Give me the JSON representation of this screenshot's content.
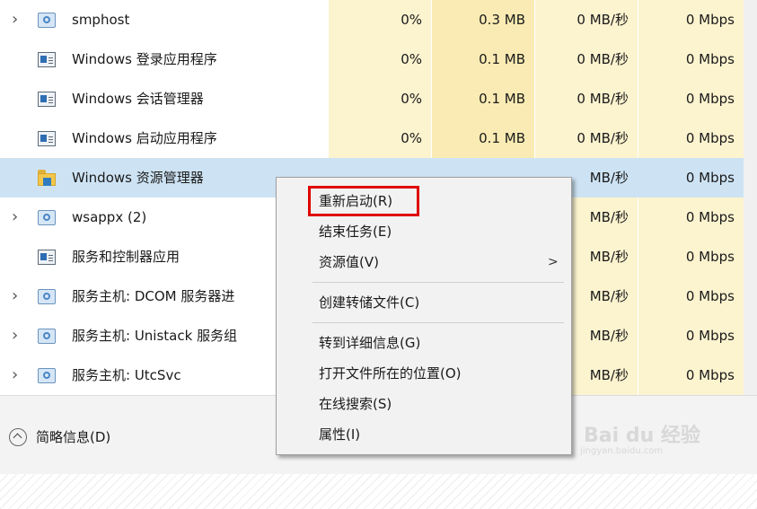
{
  "processes": [
    {
      "name": "smphost",
      "icon": "gear-icon",
      "expandable": true,
      "cpu": "0%",
      "memory": "0.3 MB",
      "disk": "0 MB/秒",
      "network": "0 Mbps"
    },
    {
      "name": "Windows 登录应用程序",
      "icon": "window-icon",
      "expandable": false,
      "cpu": "0%",
      "memory": "0.1 MB",
      "disk": "0 MB/秒",
      "network": "0 Mbps"
    },
    {
      "name": "Windows 会话管理器",
      "icon": "window-icon",
      "expandable": false,
      "cpu": "0%",
      "memory": "0.1 MB",
      "disk": "0 MB/秒",
      "network": "0 Mbps"
    },
    {
      "name": "Windows 启动应用程序",
      "icon": "window-icon",
      "expandable": false,
      "cpu": "0%",
      "memory": "0.1 MB",
      "disk": "0 MB/秒",
      "network": "0 Mbps"
    },
    {
      "name": "Windows 资源管理器",
      "icon": "explorer-folder-icon",
      "expandable": false,
      "selected": true,
      "cpu": "",
      "memory": "",
      "disk": "MB/秒",
      "network": "0 Mbps"
    },
    {
      "name": "wsappx (2)",
      "icon": "gear-icon",
      "expandable": true,
      "cpu": "",
      "memory": "",
      "disk": "MB/秒",
      "network": "0 Mbps"
    },
    {
      "name": "服务和控制器应用",
      "icon": "window-icon",
      "expandable": false,
      "cpu": "",
      "memory": "",
      "disk": "MB/秒",
      "network": "0 Mbps"
    },
    {
      "name": "服务主机: DCOM 服务器进",
      "icon": "gear-icon",
      "expandable": true,
      "cpu": "",
      "memory": "",
      "disk": "MB/秒",
      "network": "0 Mbps"
    },
    {
      "name": "服务主机: Unistack 服务组",
      "icon": "gear-icon",
      "expandable": true,
      "cpu": "",
      "memory": "",
      "disk": "MB/秒",
      "network": "0 Mbps"
    },
    {
      "name": "服务主机: UtcSvc",
      "icon": "gear-icon",
      "expandable": true,
      "cpu": "",
      "memory": "",
      "disk": "MB/秒",
      "network": "0 Mbps"
    }
  ],
  "footer": {
    "collapse_label": "简略信息(D)",
    "watermark": "Bai du 经验",
    "watermark_sub": "jingyan.baidu.com"
  },
  "context_menu": {
    "items": [
      {
        "label": "重新启动(R)",
        "highlighted": true
      },
      {
        "label": "结束任务(E)"
      },
      {
        "label": "资源值(V)",
        "submenu": true,
        "arrow": ">"
      },
      {
        "label": "创建转储文件(C)"
      },
      {
        "label": "转到详细信息(G)"
      },
      {
        "label": "打开文件所在的位置(O)"
      },
      {
        "label": "在线搜索(S)"
      },
      {
        "label": "属性(I)"
      }
    ]
  },
  "colors": {
    "selected_row": "#cde3f4",
    "cpu_heat": "#fcf3cf",
    "memory_heat": "#f9ebb3",
    "highlight_box": "#e00000"
  }
}
